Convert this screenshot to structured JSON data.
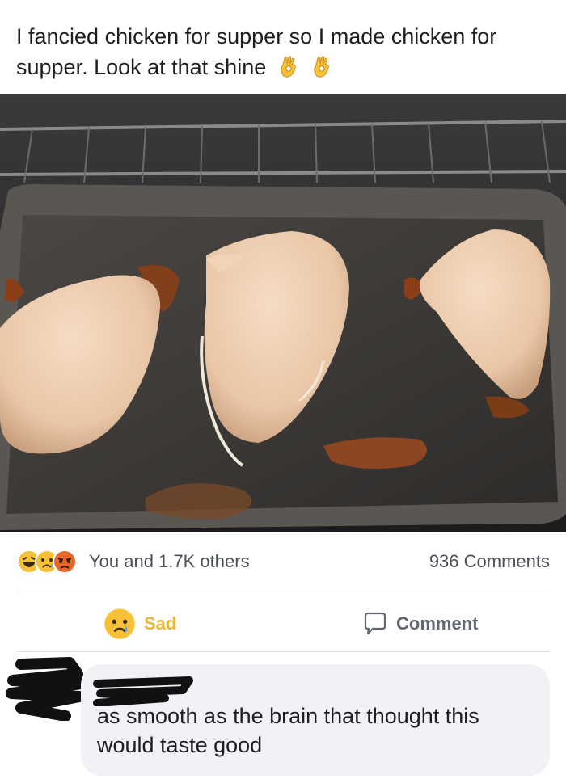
{
  "post": {
    "text": "I fancied chicken for supper so I made chicken for supper. Look at that shine",
    "emoji": [
      "ok-hand-emoji",
      "ok-hand-emoji"
    ]
  },
  "photo": {
    "icon": "chicken-on-baking-tray-photo"
  },
  "reactions": {
    "icons": [
      "haha-reaction-icon",
      "sad-reaction-icon",
      "angry-reaction-icon"
    ],
    "summary": "You and 1.7K others",
    "comments": "936 Comments"
  },
  "actions": {
    "sad_label": "Sad",
    "comment_label": "Comment",
    "sad_color": "#e9b640",
    "comment_color": "#606770"
  },
  "comment": {
    "text": "as smooth as the brain that thought this would taste good",
    "bubble_color": "#f0f2f5"
  }
}
